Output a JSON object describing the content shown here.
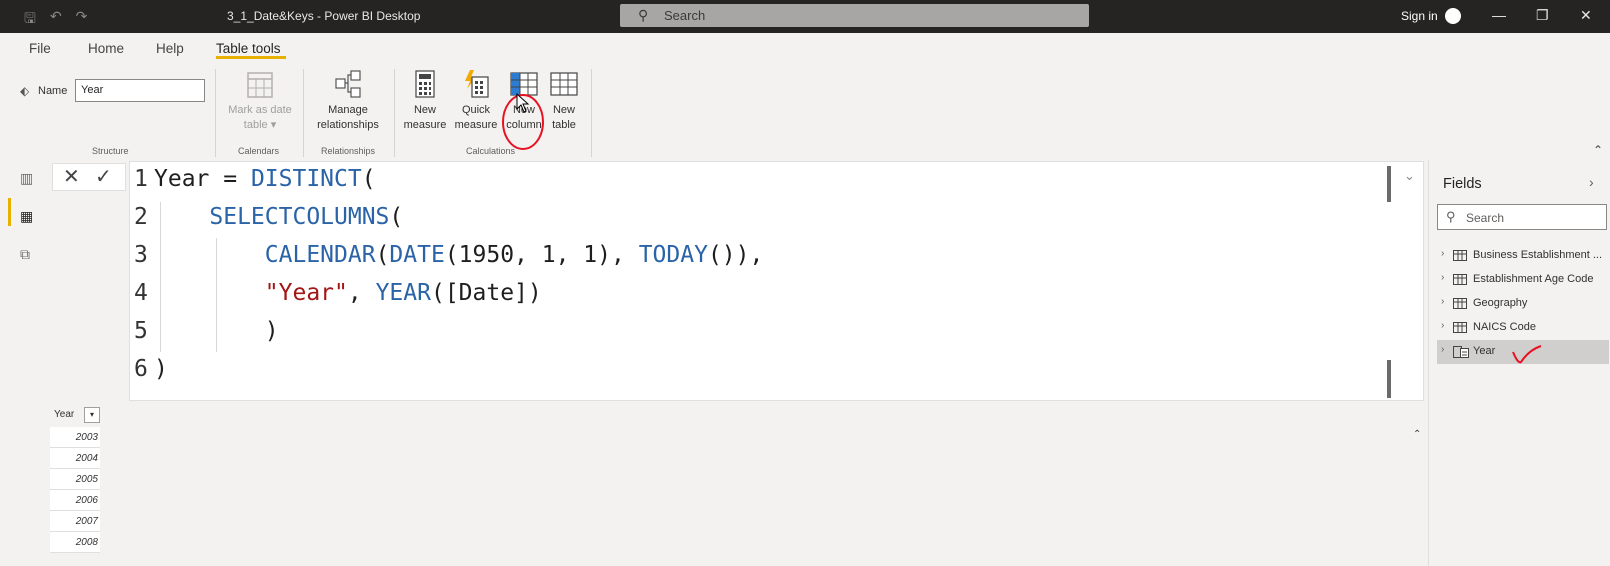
{
  "window": {
    "title": "3_1_Date&Keys - Power BI Desktop",
    "search_placeholder": "Search",
    "sign_in": "Sign in"
  },
  "menu": {
    "tabs": [
      "File",
      "Home",
      "Help",
      "Table tools"
    ],
    "active_tab": "Table tools"
  },
  "ribbon": {
    "name_label": "Name",
    "name_value": "Year",
    "structure_label": "Structure",
    "mark_as_date_line1": "Mark as date",
    "mark_as_date_line2": "table ▾",
    "calendars_label": "Calendars",
    "manage_rel_line1": "Manage",
    "manage_rel_line2": "relationships",
    "relationships_label": "Relationships",
    "new_measure_line1": "New",
    "new_measure_line2": "measure",
    "quick_measure_line1": "Quick",
    "quick_measure_line2": "measure",
    "new_column_line1": "New",
    "new_column_line2": "column",
    "new_table_line1": "New",
    "new_table_line2": "table",
    "calculations_label": "Calculations"
  },
  "formula": {
    "lines": [
      {
        "num": "1",
        "parts": [
          {
            "t": "Year = ",
            "c": "txt"
          },
          {
            "t": "DISTINCT",
            "c": "kw"
          },
          {
            "t": "(",
            "c": "txt"
          }
        ]
      },
      {
        "num": "2",
        "parts": [
          {
            "t": "    ",
            "c": "txt"
          },
          {
            "t": "SELECTCOLUMNS",
            "c": "kw"
          },
          {
            "t": "(",
            "c": "txt"
          }
        ]
      },
      {
        "num": "3",
        "parts": [
          {
            "t": "        ",
            "c": "txt"
          },
          {
            "t": "CALENDAR",
            "c": "kw"
          },
          {
            "t": "(",
            "c": "txt"
          },
          {
            "t": "DATE",
            "c": "kw"
          },
          {
            "t": "(1950, 1, 1), ",
            "c": "txt"
          },
          {
            "t": "TODAY",
            "c": "kw"
          },
          {
            "t": "()),",
            "c": "txt"
          }
        ]
      },
      {
        "num": "4",
        "parts": [
          {
            "t": "        ",
            "c": "txt"
          },
          {
            "t": "\"Year\"",
            "c": "str"
          },
          {
            "t": ", ",
            "c": "txt"
          },
          {
            "t": "YEAR",
            "c": "kw"
          },
          {
            "t": "([Date])",
            "c": "txt"
          }
        ]
      },
      {
        "num": "5",
        "parts": [
          {
            "t": "        )",
            "c": "txt"
          }
        ]
      },
      {
        "num": "6",
        "parts": [
          {
            "t": ")",
            "c": "txt"
          }
        ]
      }
    ]
  },
  "table": {
    "column_header": "Year",
    "rows": [
      "2003",
      "2004",
      "2005",
      "2006",
      "2007",
      "2008"
    ]
  },
  "fields": {
    "title": "Fields",
    "search_placeholder": "Search",
    "items": [
      {
        "label": "Business Establishment ...",
        "selected": false
      },
      {
        "label": "Establishment Age Code",
        "selected": false
      },
      {
        "label": "Geography",
        "selected": false
      },
      {
        "label": "NAICS Code",
        "selected": false
      },
      {
        "label": "Year",
        "selected": true
      }
    ]
  },
  "colors": {
    "accent": "#e8b100",
    "annotation_red": "#e81123",
    "keyword_blue": "#2a63a8",
    "string_red": "#a31515"
  }
}
